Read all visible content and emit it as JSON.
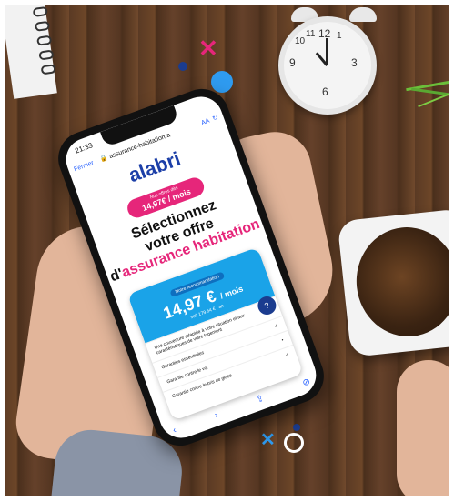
{
  "colors": {
    "brand_pink": "#e6267a",
    "brand_blue": "#1c3fa8",
    "card_blue": "#1aa3e8",
    "accent_light_blue": "#2f9bf0"
  },
  "phone": {
    "status_time": "21:33",
    "close_label": "Fermer",
    "url_text": "assurance-habitation.a",
    "reader_label": "AA",
    "logo_text": "alabri",
    "tagline": "",
    "pill_small": "Nos offres dès",
    "pill_price": "14,97€ / mois",
    "headline_line1": "Sélectionnez",
    "headline_line2": "votre offre",
    "headline_line3_prefix": "d'",
    "headline_line3_highlight": "assurance habitation",
    "card_badge": "Notre recommandation",
    "card_price": "14,97 €",
    "card_price_unit": "/ mois",
    "card_annual": "soit 179,64 € / an",
    "features": [
      "Une couverture adaptée à votre situation et aux caractéristiques de votre logement",
      "Garanties essentielles",
      "Garantie contre le vol",
      "Garantie contre le bris de glace"
    ],
    "nav_back": "‹",
    "nav_forward": "›",
    "nav_share": "⇪",
    "nav_compass": "⊘"
  },
  "clock": {
    "numbers": [
      "12",
      "3",
      "6",
      "9",
      "10",
      "11",
      "1"
    ]
  },
  "icons": {
    "cross_pink": "x-mark-icon",
    "cross_blue": "x-mark-icon",
    "ring": "circle-icon",
    "chat": "chat-bubble-icon"
  }
}
